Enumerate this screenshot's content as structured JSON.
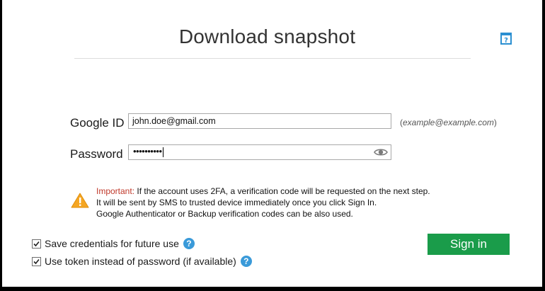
{
  "dialog": {
    "title": "Download snapshot"
  },
  "form": {
    "google_id_label": "Google ID",
    "google_id_value": "john.doe@gmail.com",
    "google_id_hint_prefix": "(",
    "google_id_hint_example": "example@example.com",
    "google_id_hint_suffix": ")",
    "password_label": "Password",
    "password_masked": "••••••••••"
  },
  "notice": {
    "important_label": "Important:",
    "line1": "If the account uses 2FA, a verification code will be requested on the next step.",
    "line2": "It will be sent by SMS to trusted device immediately once you click Sign In.",
    "line3": "Google Authenticator or Backup verification codes can be also used."
  },
  "options": {
    "save_credentials_label": "Save credentials for future use",
    "save_credentials_checked": true,
    "use_token_label": "Use token instead of password (if available)",
    "use_token_checked": true,
    "help_glyph": "?"
  },
  "actions": {
    "sign_in_label": "Sign in"
  },
  "colors": {
    "accent_green": "#1a9c4a",
    "help_blue": "#3a9ad9",
    "warning_orange": "#f5a623",
    "important_red": "#c0392b"
  },
  "icons": {
    "help_book": "help-book-icon",
    "eye": "eye-icon",
    "warning": "warning-triangle-icon",
    "question": "question-circle-icon"
  }
}
